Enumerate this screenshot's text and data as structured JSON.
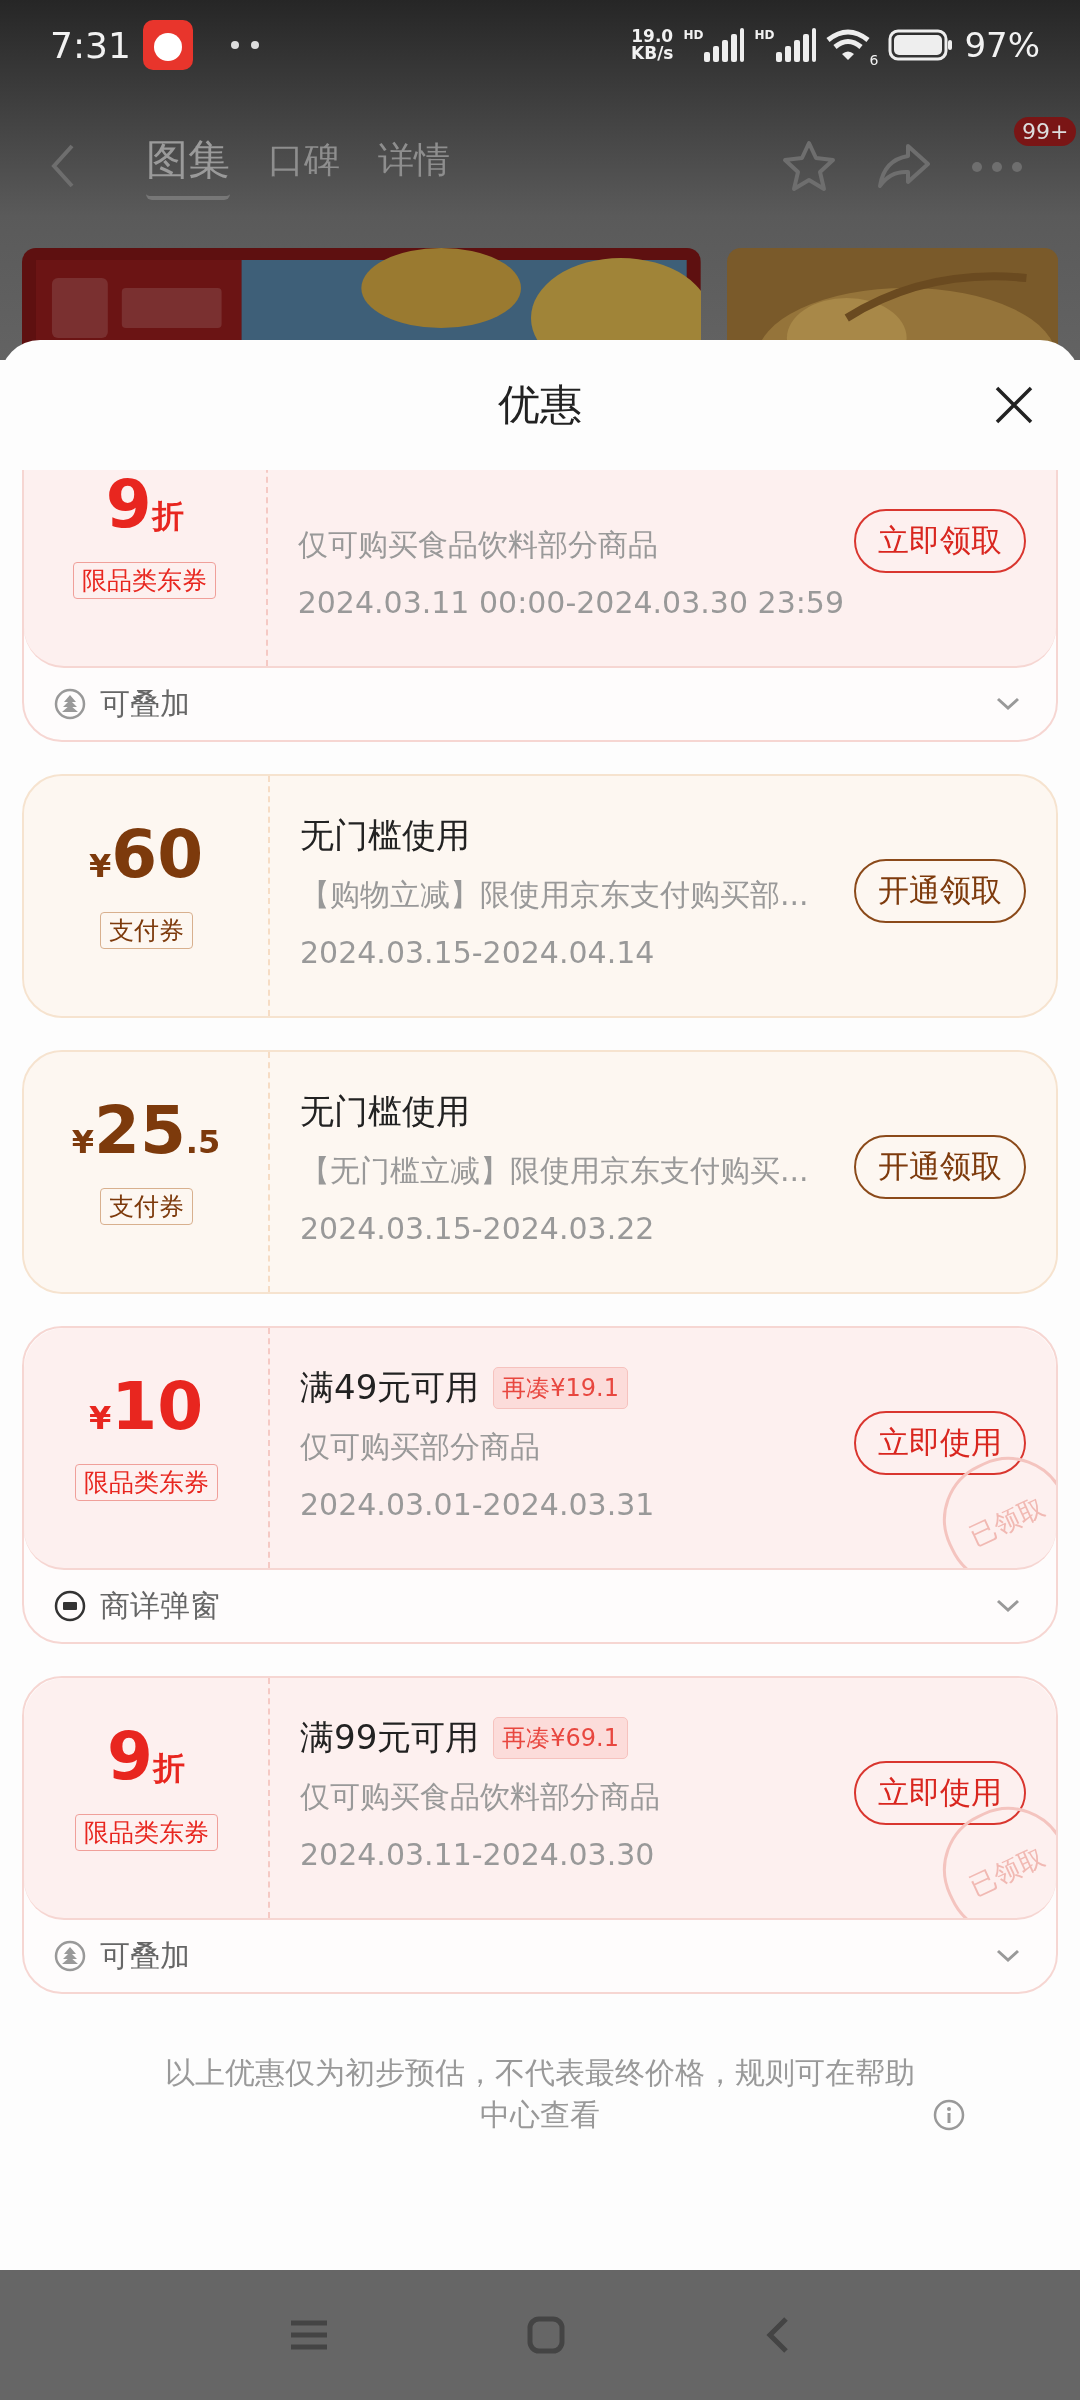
{
  "status_bar": {
    "time": "7:31",
    "net_speed": [
      "19.0",
      "KB/s"
    ],
    "signal_labels": [
      "HD",
      "HD"
    ],
    "wifi_label": "6",
    "battery": "97%"
  },
  "nav": {
    "tabs": [
      {
        "label": "图集",
        "selected": true
      },
      {
        "label": "口碑",
        "selected": false
      },
      {
        "label": "详情",
        "selected": false
      }
    ],
    "badge": "99+"
  },
  "sheet": {
    "title": "优惠"
  },
  "coupons": [
    {
      "kind": "category",
      "amount": {
        "value": "9",
        "suffix": "折"
      },
      "tag": "限品类东券",
      "desc": "仅可购买食品饮料部分商品",
      "date": "2024.03.11 00:00-2024.03.30 23:59",
      "button": "立即领取",
      "footer": {
        "kind": "stack",
        "text": "可叠加"
      }
    },
    {
      "kind": "payment",
      "amount": {
        "prefix": "¥",
        "value": "60"
      },
      "tag": "支付券",
      "title": "无门槛使用",
      "desc": "【购物立减】限使用京东支付购买部...",
      "date": "2024.03.15-2024.04.14",
      "button": "开通领取"
    },
    {
      "kind": "payment",
      "amount": {
        "prefix": "¥",
        "value": "25",
        "suffix": ".5"
      },
      "tag": "支付券",
      "title": "无门槛使用",
      "desc": "【无门槛立减】限使用京东支付购买...",
      "date": "2024.03.15-2024.03.22",
      "button": "开通领取"
    },
    {
      "kind": "category",
      "amount": {
        "prefix": "¥",
        "value": "10"
      },
      "tag": "限品类东券",
      "title": "满49元可用",
      "gap_tag": "再凑¥19.1",
      "desc": "仅可购买部分商品",
      "date": "2024.03.01-2024.03.31",
      "button": "立即使用",
      "stamp": "已领取",
      "footer": {
        "kind": "popup",
        "text": "商详弹窗"
      }
    },
    {
      "kind": "category",
      "amount": {
        "value": "9",
        "suffix": "折"
      },
      "tag": "限品类东券",
      "title": "满99元可用",
      "gap_tag": "再凑¥69.1",
      "desc": "仅可购买食品饮料部分商品",
      "date": "2024.03.11-2024.03.30",
      "button": "立即使用",
      "stamp": "已领取",
      "footer": {
        "kind": "stack",
        "text": "可叠加"
      }
    }
  ],
  "notice": "以上优惠仅为初步预估，不代表最终价格，规则可在帮助中心查看"
}
